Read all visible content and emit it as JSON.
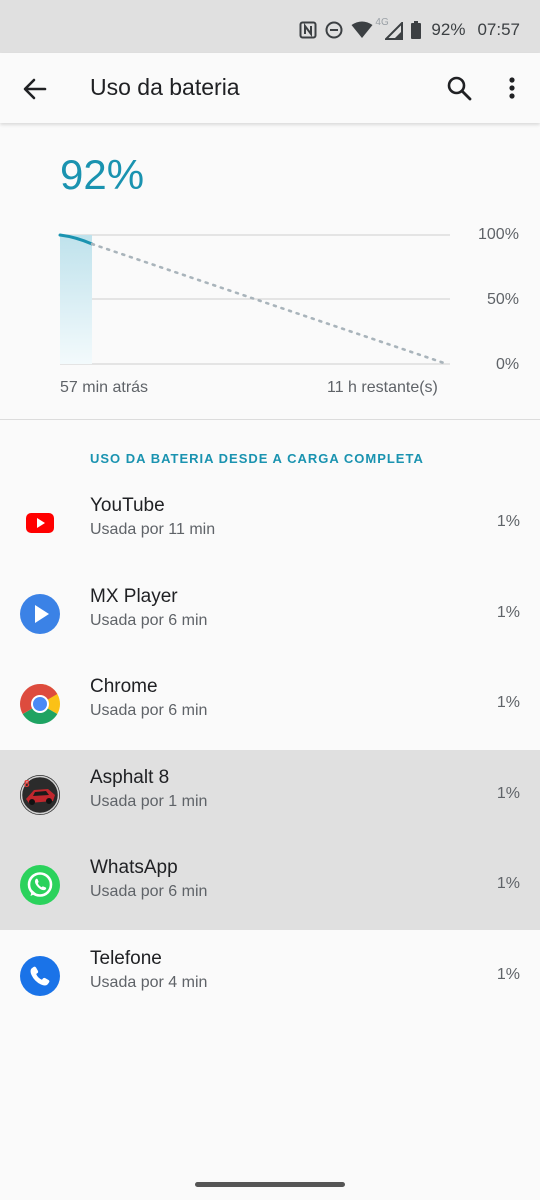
{
  "status_bar": {
    "battery_percent": "92%",
    "time": "07:57",
    "network": "4G",
    "icons": [
      "nfc-icon",
      "do-not-disturb-icon",
      "wifi-icon",
      "signal-icon",
      "battery-icon"
    ]
  },
  "toolbar": {
    "title": "Uso da bateria",
    "icons": [
      "back-arrow-icon",
      "search-icon",
      "more-vert-icon"
    ]
  },
  "summary": {
    "battery_level": "92%",
    "accent_color": "#1a93b0",
    "chart_labels": {
      "start": "57 min atrás",
      "end": "11 h restante(s)",
      "y_ticks": [
        "100%",
        "50%",
        "0%"
      ]
    }
  },
  "usage_section": {
    "title": "USO DA BATERIA DESDE A CARGA COMPLETA",
    "apps": [
      {
        "name": "YouTube",
        "usage": "Usada por 11 min",
        "percent": "1%",
        "icon": "youtube-icon"
      },
      {
        "name": "MX Player",
        "usage": "Usada por 6 min",
        "percent": "1%",
        "icon": "mx-player-icon"
      },
      {
        "name": "Chrome",
        "usage": "Usada por 6 min",
        "percent": "1%",
        "icon": "chrome-icon"
      },
      {
        "name": "Asphalt 8",
        "usage": "Usada por 1 min",
        "percent": "1%",
        "icon": "asphalt-8-icon"
      },
      {
        "name": "WhatsApp",
        "usage": "Usada por 6 min",
        "percent": "1%",
        "icon": "whatsapp-icon"
      },
      {
        "name": "Telefone",
        "usage": "Usada por 4 min",
        "percent": "1%",
        "icon": "phone-icon"
      }
    ]
  }
}
